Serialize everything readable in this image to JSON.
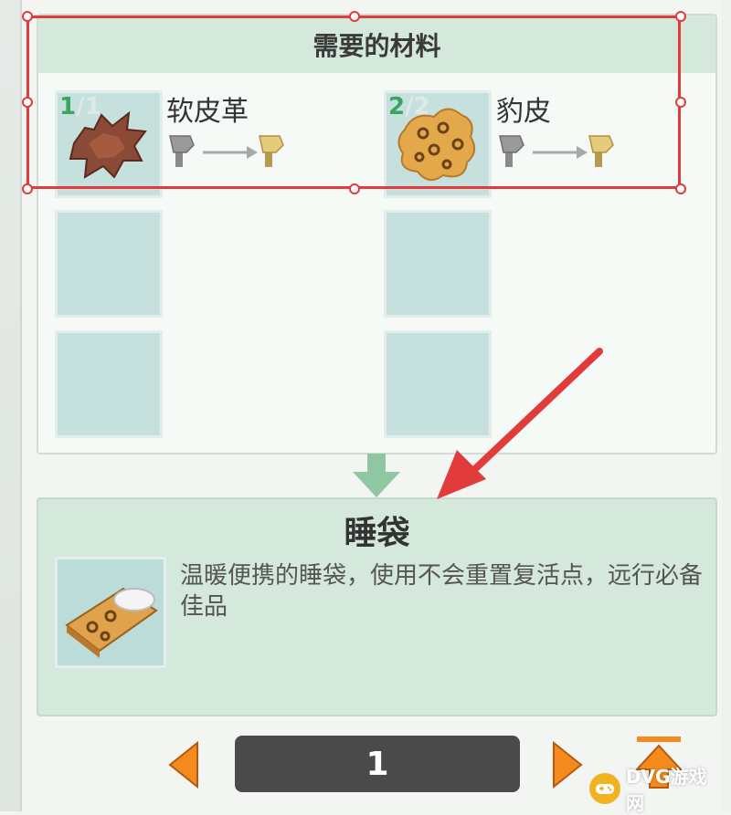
{
  "materials_panel": {
    "title": "需要的材料",
    "items": [
      {
        "name": "软皮革",
        "have": "1",
        "need": "/1",
        "icon": "leather-hide-icon"
      },
      {
        "name": "豹皮",
        "have": "2",
        "need": "/2",
        "icon": "leopard-skin-icon"
      }
    ]
  },
  "result": {
    "name": "睡袋",
    "description": "温暖便携的睡袋，使用不会重置复活点，远行必备佳品",
    "icon": "sleeping-bag-icon"
  },
  "pager": {
    "page": "1"
  },
  "watermark": {
    "text": "DVG游戏网"
  },
  "colors": {
    "panel_header": "#d4e8dc",
    "slot": "#c6e1dd",
    "count_green": "#3aa55e",
    "highlight_red": "#e23b3b",
    "nav_orange": "#f58a1f",
    "pager_bg": "#4a4a4a"
  }
}
